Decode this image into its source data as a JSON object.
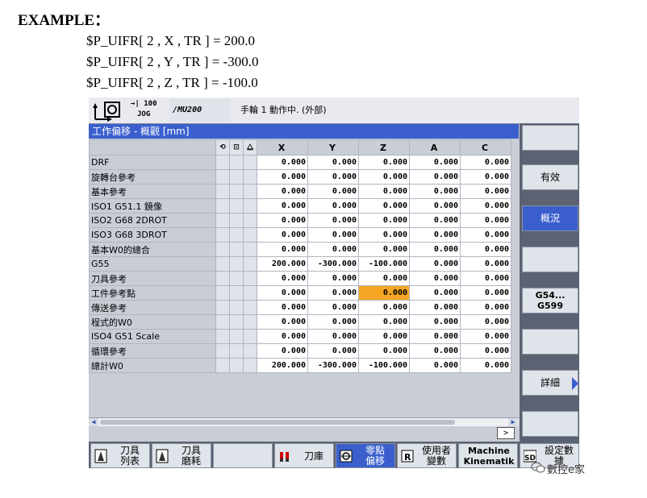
{
  "doc": {
    "heading": "EXAMPLE：",
    "code_lines": [
      "$P_UIFR[ 2 , X , TR ] = 200.0",
      "$P_UIFR[ 2 , Y , TR ] = -300.0",
      "$P_UIFR[ 2 , Z , TR ] = -100.0"
    ]
  },
  "status": {
    "mode_line1": "→| 100",
    "mode_line2": "JOG",
    "program": "/MU200",
    "message": "手輪 1 動作中. (外部)"
  },
  "panel": {
    "title": "工作偏移 - 概觀 [mm]",
    "columns": [
      "X",
      "Y",
      "Z",
      "A",
      "C"
    ],
    "rows": [
      {
        "name": "DRF",
        "values": [
          "0.000",
          "0.000",
          "0.000",
          "0.000",
          "0.000"
        ]
      },
      {
        "name": "旋轉台參考",
        "values": [
          "0.000",
          "0.000",
          "0.000",
          "0.000",
          "0.000"
        ]
      },
      {
        "name": "基本參考",
        "values": [
          "0.000",
          "0.000",
          "0.000",
          "0.000",
          "0.000"
        ]
      },
      {
        "name": "ISO1 G51.1 鏡像",
        "values": [
          "0.000",
          "0.000",
          "0.000",
          "0.000",
          "0.000"
        ]
      },
      {
        "name": "ISO2 G68 2DROT",
        "values": [
          "0.000",
          "0.000",
          "0.000",
          "0.000",
          "0.000"
        ]
      },
      {
        "name": "ISO3 G68 3DROT",
        "values": [
          "0.000",
          "0.000",
          "0.000",
          "0.000",
          "0.000"
        ]
      },
      {
        "name": "基本W0的總合",
        "values": [
          "0.000",
          "0.000",
          "0.000",
          "0.000",
          "0.000"
        ]
      },
      {
        "name": "G55",
        "values": [
          "200.000",
          "-300.000",
          "-100.000",
          "0.000",
          "0.000"
        ]
      },
      {
        "name": "刀具參考",
        "values": [
          "0.000",
          "0.000",
          "0.000",
          "0.000",
          "0.000"
        ]
      },
      {
        "name": "工件參考點",
        "values": [
          "0.000",
          "0.000",
          "0.000",
          "0.000",
          "0.000"
        ]
      },
      {
        "name": "傳送參考",
        "values": [
          "0.000",
          "0.000",
          "0.000",
          "0.000",
          "0.000"
        ]
      },
      {
        "name": "程式的W0",
        "values": [
          "0.000",
          "0.000",
          "0.000",
          "0.000",
          "0.000"
        ]
      },
      {
        "name": "ISO4 G51 Scale",
        "values": [
          "0.000",
          "0.000",
          "0.000",
          "0.000",
          "0.000"
        ]
      },
      {
        "name": "循環參考",
        "values": [
          "0.000",
          "0.000",
          "0.000",
          "0.000",
          "0.000"
        ]
      },
      {
        "name": "總計W0",
        "values": [
          "200.000",
          "-300.000",
          "-100.000",
          "0.000",
          "0.000"
        ]
      }
    ]
  },
  "vertical_softkeys": [
    "",
    "有效",
    "概況",
    "",
    "G54...\nG599",
    "",
    "詳細",
    ""
  ],
  "horizontal_softkeys": [
    {
      "label": "刀具\n列表"
    },
    {
      "label": "刀具\n磨耗"
    },
    {
      "label": ""
    },
    {
      "label": "刀庫"
    },
    {
      "label": "零點\n偏移"
    },
    {
      "label": "使用者\n變數"
    },
    {
      "label": "Machine\nKinematik"
    },
    {
      "label": "設定數\n據"
    }
  ],
  "watermark": "數控e家",
  "colors": {
    "accent": "#3a5fcd",
    "selection": "#f5a623"
  }
}
